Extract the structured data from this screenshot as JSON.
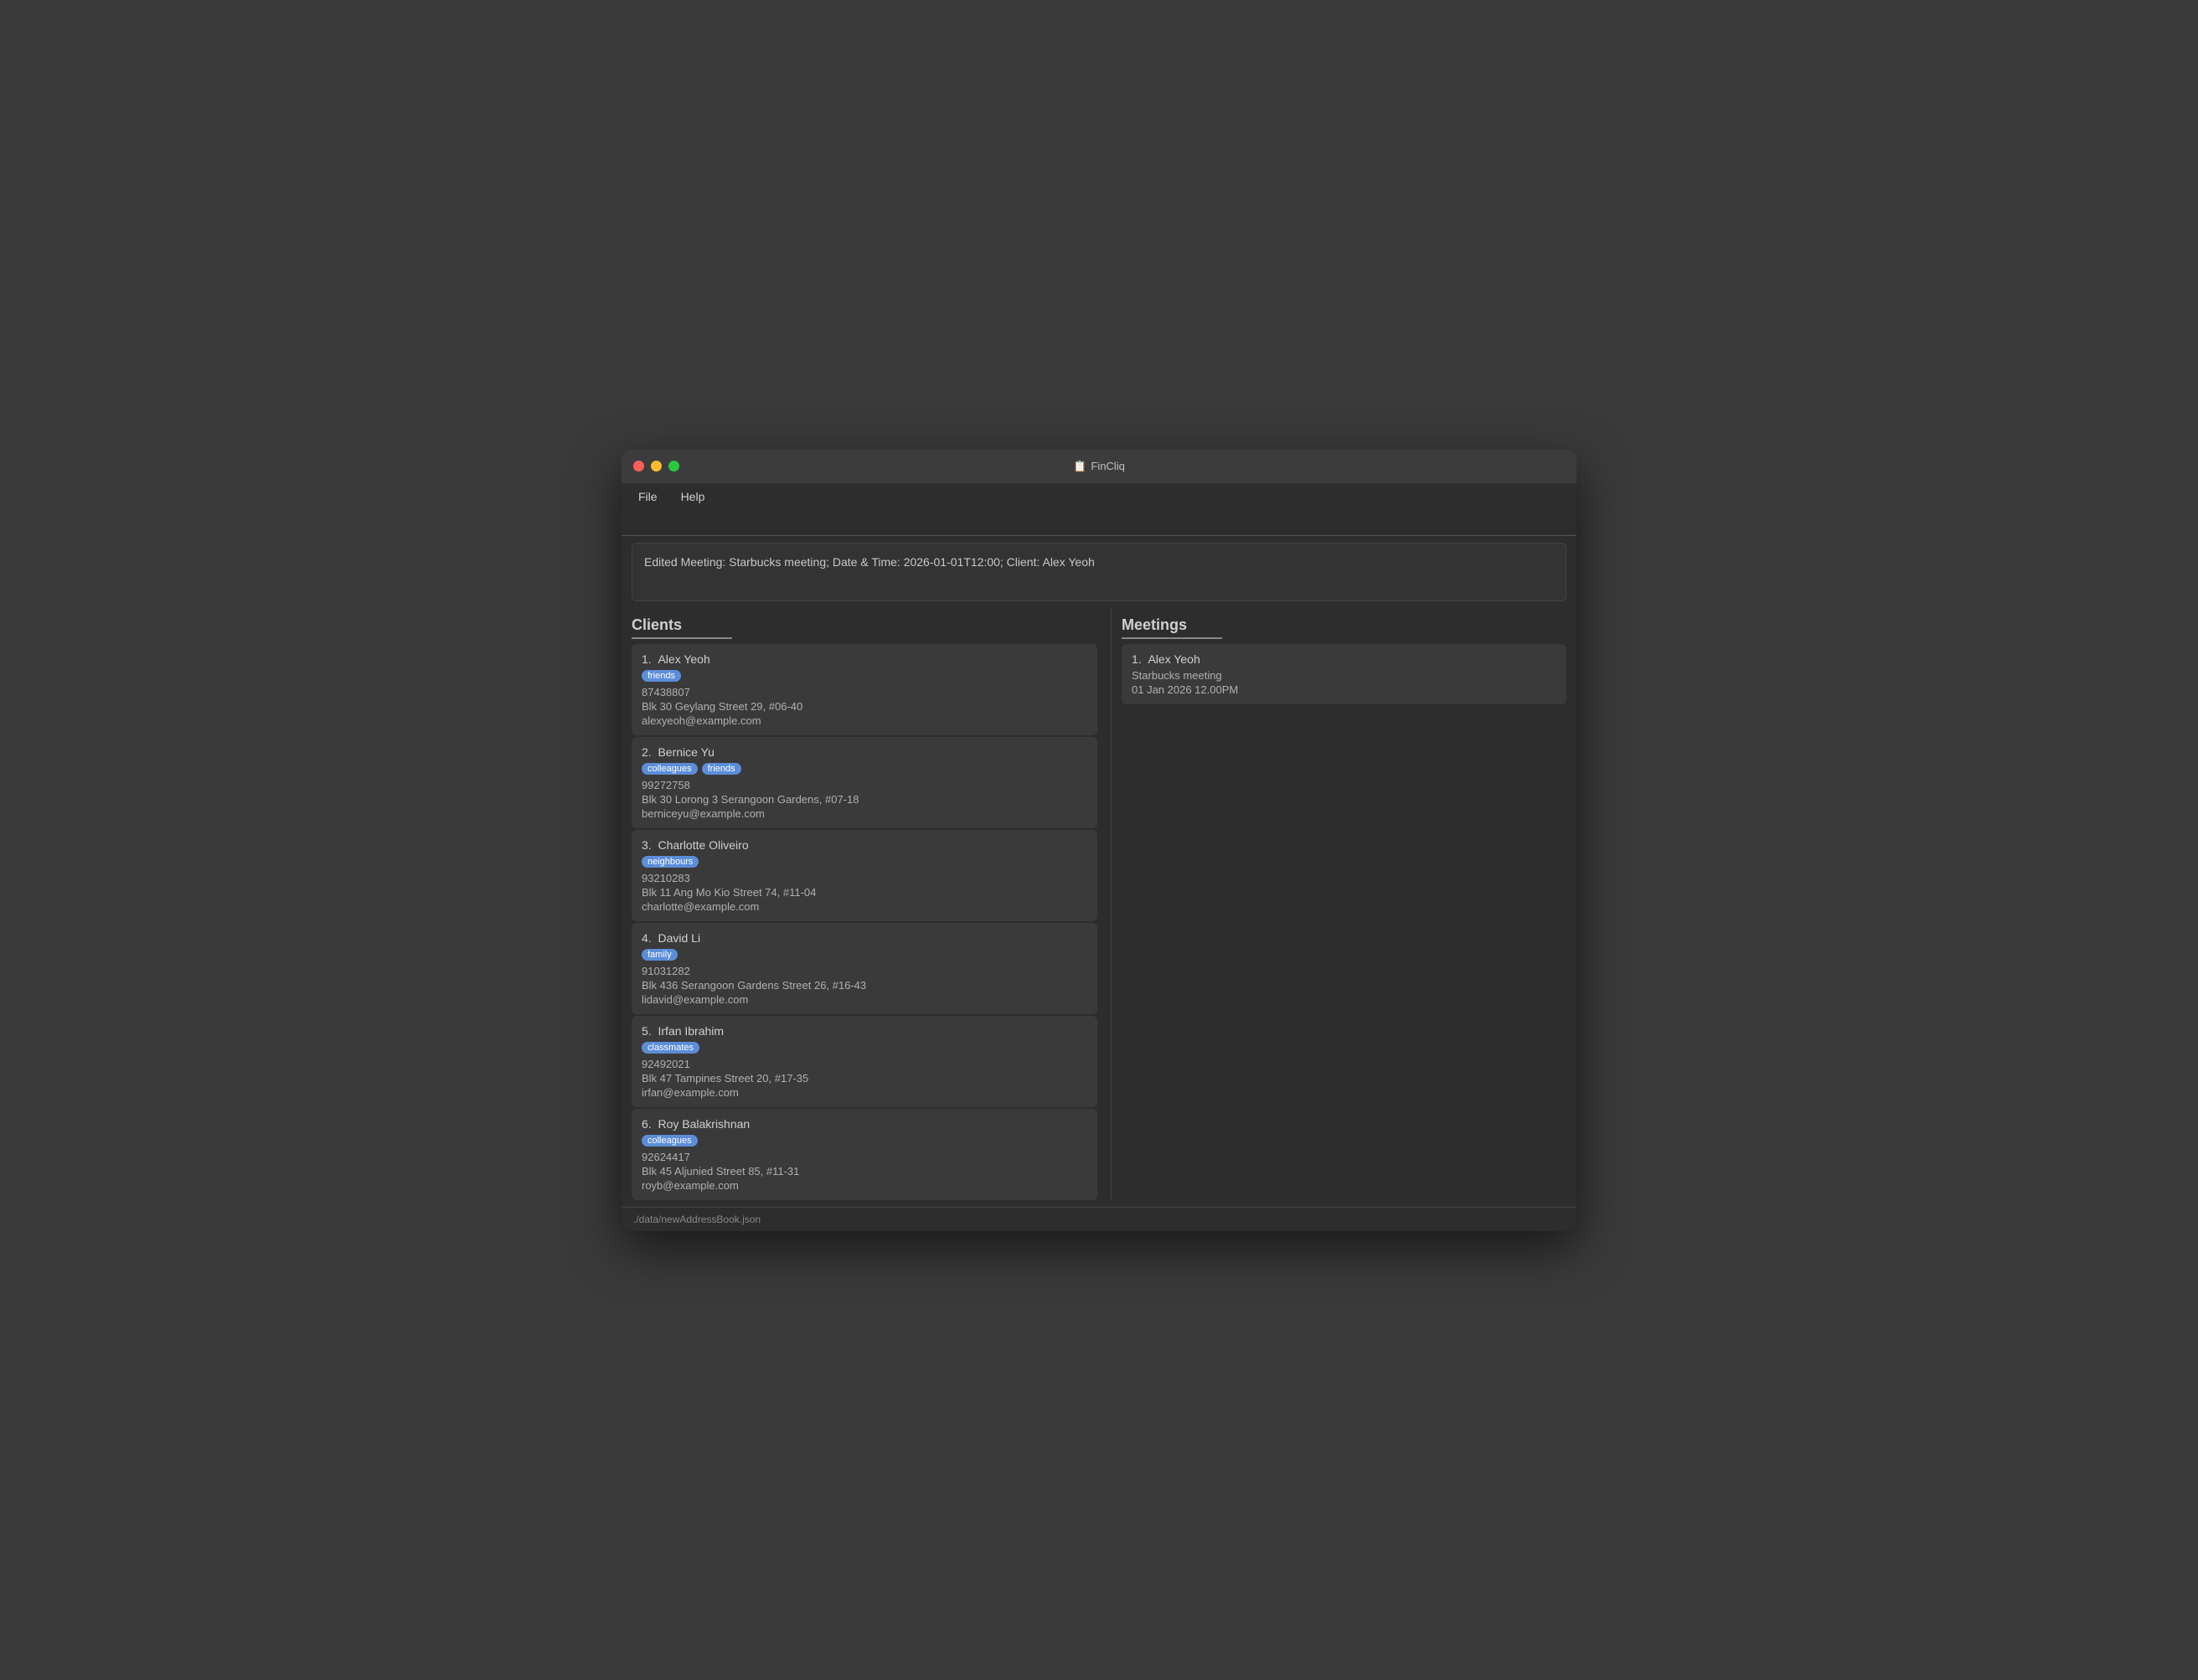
{
  "window": {
    "title": "FinCliq",
    "title_icon": "📋"
  },
  "menu": {
    "items": [
      {
        "label": "File"
      },
      {
        "label": "Help"
      }
    ]
  },
  "search": {
    "placeholder": "",
    "value": ""
  },
  "output": {
    "text": "Edited Meeting: Starbucks meeting; Date & Time: 2026-01-01T12:00; Client: Alex Yeoh"
  },
  "clients_panel": {
    "header": "Clients"
  },
  "meetings_panel": {
    "header": "Meetings"
  },
  "clients": [
    {
      "number": "1.",
      "name": "Alex Yeoh",
      "tags": [
        "friends"
      ],
      "phone": "87438807",
      "address": "Blk 30 Geylang Street 29, #06-40",
      "email": "alexyeoh@example.com"
    },
    {
      "number": "2.",
      "name": "Bernice Yu",
      "tags": [
        "colleagues",
        "friends"
      ],
      "phone": "99272758",
      "address": "Blk 30 Lorong 3 Serangoon Gardens, #07-18",
      "email": "berniceyu@example.com"
    },
    {
      "number": "3.",
      "name": "Charlotte Oliveiro",
      "tags": [
        "neighbours"
      ],
      "phone": "93210283",
      "address": "Blk 11 Ang Mo Kio Street 74, #11-04",
      "email": "charlotte@example.com"
    },
    {
      "number": "4.",
      "name": "David Li",
      "tags": [
        "family"
      ],
      "phone": "91031282",
      "address": "Blk 436 Serangoon Gardens Street 26, #16-43",
      "email": "lidavid@example.com"
    },
    {
      "number": "5.",
      "name": "Irfan Ibrahim",
      "tags": [
        "classmates"
      ],
      "phone": "92492021",
      "address": "Blk 47 Tampines Street 20, #17-35",
      "email": "irfan@example.com"
    },
    {
      "number": "6.",
      "name": "Roy Balakrishnan",
      "tags": [
        "colleagues"
      ],
      "phone": "92624417",
      "address": "Blk 45 Aljunied Street 85, #11-31",
      "email": "royb@example.com"
    }
  ],
  "meetings": [
    {
      "number": "1.",
      "client": "Alex Yeoh",
      "title": "Starbucks meeting",
      "datetime": "01 Jan 2026 12.00PM"
    }
  ],
  "status_bar": {
    "text": "./data/newAddressBook.json"
  }
}
